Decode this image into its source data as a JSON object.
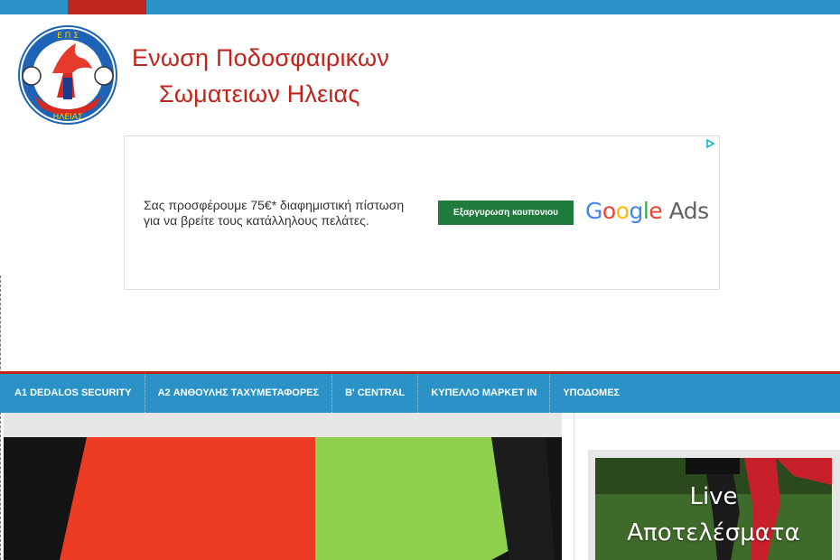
{
  "site": {
    "title_line1": "Ενωση Ποδοσφαιρικων",
    "title_line2": "Σωματειων Ηλειας",
    "logo_ring_text_top": "Ε Π Σ",
    "logo_ring_text_bottom": "ΗΛΕΙΑΣ"
  },
  "colors": {
    "primary_blue": "#2a92c6",
    "accent_red": "#c0251c",
    "ad_button": "#1f7a3d"
  },
  "ad": {
    "copy_line1": "Σας προσφέρουμε 75€* διαφημιστική πίστωση",
    "copy_line2": "για να βρείτε τους κατάλληλους πελάτες.",
    "cta_label": "Εξαργυρωση κουπονιου",
    "brand_google": "Google",
    "brand_ads": "Ads",
    "adchoices_icon": "adchoices-triangle-icon"
  },
  "nav": {
    "items": [
      {
        "label": "A1 DEDALOS SECURITY"
      },
      {
        "label": "A2 ΑΝΘΟΥΛΗΣ ΤΑΧΥΜΕΤΑΦΟΡΕΣ"
      },
      {
        "label": "B' CENTRAL"
      },
      {
        "label": "ΚΥΠΕΛΛΟ ΜΑΡΚΕΤ ΙΝ"
      },
      {
        "label": "ΥΠΟΔΟΜΕΣ"
      }
    ]
  },
  "sidebar": {
    "live_widget": {
      "line1": "Live",
      "line2": "Αποτελέσματα"
    }
  }
}
